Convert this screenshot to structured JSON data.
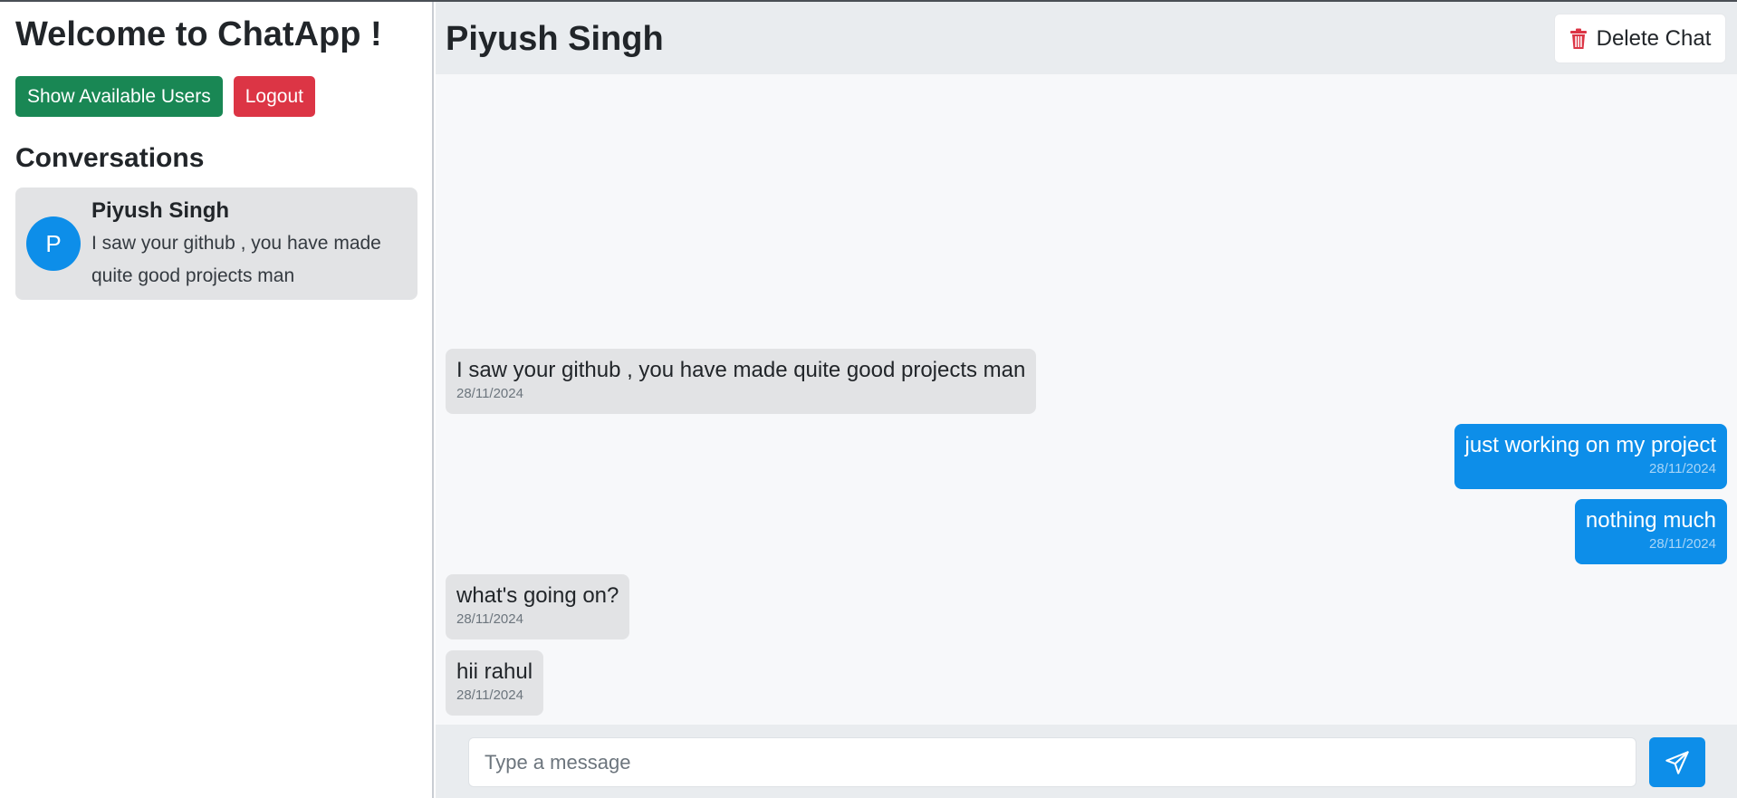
{
  "sidebar": {
    "welcome": "Welcome to ChatApp !",
    "show_users_label": "Show Available Users",
    "logout_label": "Logout",
    "section_title": "Conversations",
    "conversations": [
      {
        "avatar_letter": "P",
        "name": "Piyush Singh",
        "preview": "I saw your github , you have made quite good projects man"
      }
    ]
  },
  "chat": {
    "title": "Piyush Singh",
    "delete_label": "Delete Chat",
    "messages": [
      {
        "direction": "in",
        "text": "I saw your github , you have made quite good projects man",
        "date": "28/11/2024"
      },
      {
        "direction": "out",
        "text": "just working on my project",
        "date": "28/11/2024"
      },
      {
        "direction": "out",
        "text": "nothing much",
        "date": "28/11/2024"
      },
      {
        "direction": "in",
        "text": "what's going on?",
        "date": "28/11/2024"
      },
      {
        "direction": "in",
        "text": "hii rahul",
        "date": "28/11/2024"
      }
    ],
    "input_placeholder": "Type a message"
  },
  "icons": {
    "delete": "trash-icon",
    "send": "paper-plane-icon"
  },
  "colors": {
    "primary": "#0d8ee9",
    "success": "#198754",
    "danger": "#dc3545",
    "incoming_bubble": "#e2e3e5"
  }
}
